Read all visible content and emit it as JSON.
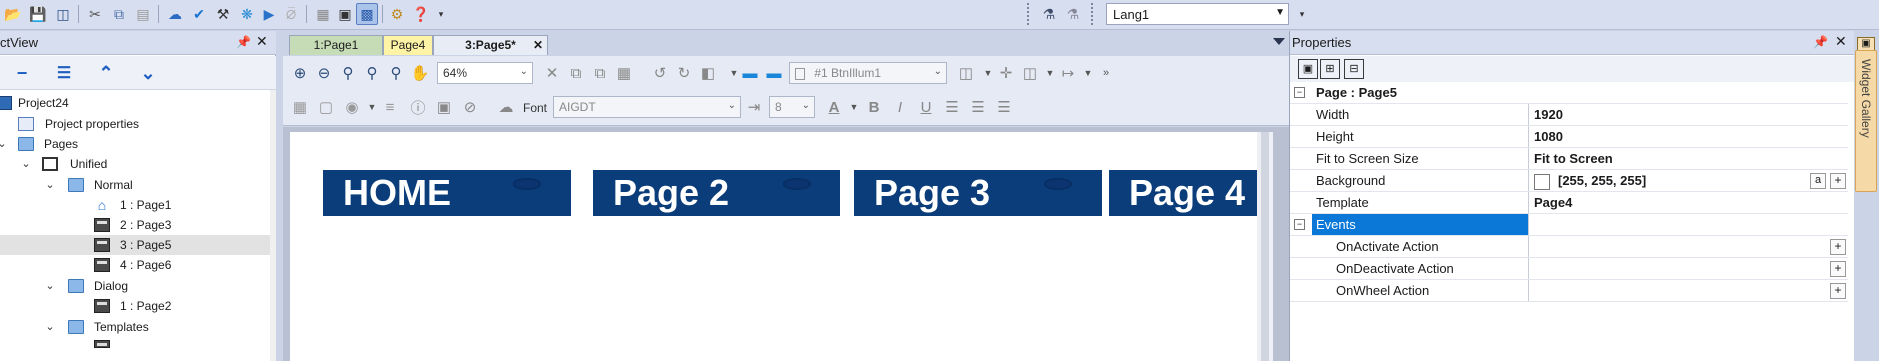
{
  "toolbar": {
    "language": "Lang1"
  },
  "project_view": {
    "title": "ctView",
    "tree": [
      {
        "label": "Project24",
        "kind": "project",
        "level": 0,
        "chevron": ""
      },
      {
        "label": "Project properties",
        "kind": "props",
        "level": 1,
        "chevron": ""
      },
      {
        "label": "Pages",
        "kind": "folder",
        "level": 1,
        "chevron": "⌄"
      },
      {
        "label": "Unified",
        "kind": "unified",
        "level": 2,
        "chevron": "⌄"
      },
      {
        "label": "Normal",
        "kind": "folder",
        "level": 3,
        "chevron": "⌄"
      },
      {
        "label": "1 : Page1",
        "kind": "home",
        "level": 4,
        "chevron": ""
      },
      {
        "label": "2 : Page3",
        "kind": "page",
        "level": 4,
        "chevron": ""
      },
      {
        "label": "3 : Page5",
        "kind": "page",
        "level": 4,
        "chevron": "",
        "selected": true
      },
      {
        "label": "4 : Page6",
        "kind": "page",
        "level": 4,
        "chevron": ""
      },
      {
        "label": "Dialog",
        "kind": "folder",
        "level": 3,
        "chevron": "⌄"
      },
      {
        "label": "1 : Page2",
        "kind": "page",
        "level": 4,
        "chevron": ""
      },
      {
        "label": "Templates",
        "kind": "folder",
        "level": 3,
        "chevron": "⌄"
      }
    ]
  },
  "tabs": [
    {
      "label": "1:Page1"
    },
    {
      "label": "Page4"
    },
    {
      "label": "3:Page5*",
      "close": "✕"
    }
  ],
  "editor": {
    "zoom": "64%",
    "widget_select": "#1 BtnIllum1",
    "font_label": "Font",
    "font_value": "AIGDT",
    "font_size": "8"
  },
  "canvas": {
    "buttons": [
      {
        "label": "HOME"
      },
      {
        "label": "Page 2"
      },
      {
        "label": "Page 3"
      },
      {
        "label": "Page 4"
      }
    ]
  },
  "properties": {
    "title": "Properties",
    "section": "Page : Page5",
    "rows": [
      {
        "key": "Width",
        "value": "1920"
      },
      {
        "key": "Height",
        "value": "1080"
      },
      {
        "key": "Fit to Screen Size",
        "value": "Fit to Screen"
      },
      {
        "key": "Background",
        "value": "[255, 255, 255]"
      },
      {
        "key": "Template",
        "value": "Page4"
      }
    ],
    "events_label": "Events",
    "events": [
      {
        "key": "OnActivate Action"
      },
      {
        "key": "OnDeactivate Action"
      },
      {
        "key": "OnWheel Action"
      }
    ],
    "bg_a_button": "a",
    "plus": "+",
    "expand_minus": "−"
  },
  "widget_gallery": {
    "label": "Widget Gallery"
  },
  "colors": {
    "accent": "#0b78d7",
    "nav_button": "#0a3d7a",
    "chrome": "#cbd3e6"
  }
}
